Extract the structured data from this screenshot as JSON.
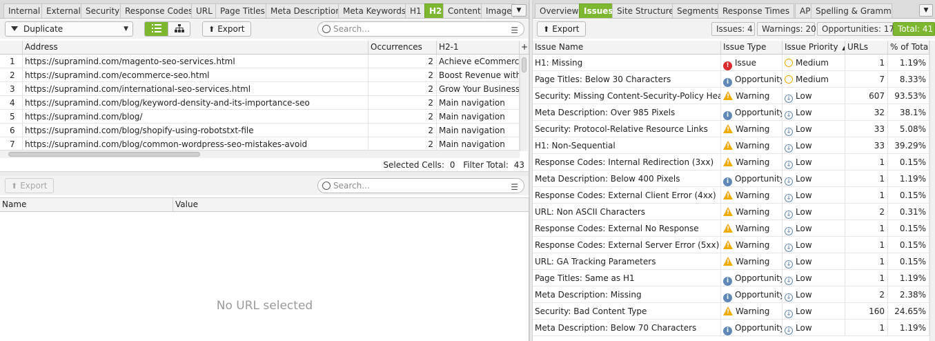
{
  "left": {
    "tabs": [
      "Internal",
      "External",
      "Security",
      "Response Codes",
      "URL",
      "Page Titles",
      "Meta Description",
      "Meta Keywords",
      "H1",
      "H2",
      "Content",
      "Images"
    ],
    "active_tab": "H2",
    "filter_value": "Duplicate",
    "export_label": "Export",
    "search_placeholder": "Search...",
    "columns": [
      "Address",
      "Occurrences",
      "H2-1"
    ],
    "rows": [
      {
        "n": "1",
        "address": "https://supramind.com/magento-seo-services.html",
        "occ": "2",
        "h2": "Achieve eCommerce S"
      },
      {
        "n": "2",
        "address": "https://supramind.com/ecommerce-seo.html",
        "occ": "2",
        "h2": "Boost Revenue with E"
      },
      {
        "n": "3",
        "address": "https://supramind.com/international-seo-services.html",
        "occ": "2",
        "h2": "Grow Your Business W"
      },
      {
        "n": "4",
        "address": "https://supramind.com/blog/keyword-density-and-its-importance-seo",
        "occ": "2",
        "h2": "Main navigation"
      },
      {
        "n": "5",
        "address": "https://supramind.com/blog/",
        "occ": "2",
        "h2": "Main navigation"
      },
      {
        "n": "6",
        "address": "https://supramind.com/blog/shopify-using-robotstxt-file",
        "occ": "2",
        "h2": "Main navigation"
      },
      {
        "n": "7",
        "address": "https://supramind.com/blog/common-wordpress-seo-mistakes-avoid",
        "occ": "2",
        "h2": "Main navigation"
      }
    ],
    "status_selected_label": "Selected Cells:",
    "status_selected_value": "0",
    "status_filter_label": "Filter Total:",
    "status_filter_value": "43",
    "detail": {
      "export_label": "Export",
      "search_placeholder": "Search...",
      "columns": [
        "Name",
        "Value"
      ],
      "empty_text": "No URL selected"
    }
  },
  "right": {
    "tabs": [
      "Overview",
      "Issues",
      "Site Structure",
      "Segments",
      "Response Times",
      "API",
      "Spelling & Grammar"
    ],
    "active_tab": "Issues",
    "export_label": "Export",
    "summary": {
      "issues": "Issues: 4",
      "warnings": "Warnings: 20",
      "opportunities": "Opportunities: 17",
      "total": "Total: 41"
    },
    "columns": [
      "Issue Name",
      "Issue Type",
      "Issue Priority",
      "URLs",
      "% of Total"
    ],
    "rows": [
      {
        "name": "H1: Missing",
        "type": "Issue",
        "type_icon": "error-icon",
        "priority": "Medium",
        "urls": "1",
        "pct": "1.19%"
      },
      {
        "name": "Page Titles: Below 30 Characters",
        "type": "Opportunity",
        "type_icon": "info-icon",
        "priority": "Medium",
        "urls": "7",
        "pct": "8.33%"
      },
      {
        "name": "Security: Missing Content-Security-Policy Header",
        "type": "Warning",
        "type_icon": "warning-icon",
        "priority": "Low",
        "urls": "607",
        "pct": "93.53%"
      },
      {
        "name": "Meta Description: Over 985 Pixels",
        "type": "Opportunity",
        "type_icon": "info-icon",
        "priority": "Low",
        "urls": "32",
        "pct": "38.1%"
      },
      {
        "name": "Security: Protocol-Relative Resource Links",
        "type": "Warning",
        "type_icon": "warning-icon",
        "priority": "Low",
        "urls": "33",
        "pct": "5.08%"
      },
      {
        "name": "H1: Non-Sequential",
        "type": "Warning",
        "type_icon": "warning-icon",
        "priority": "Low",
        "urls": "33",
        "pct": "39.29%"
      },
      {
        "name": "Response Codes: Internal Redirection (3xx)",
        "type": "Warning",
        "type_icon": "warning-icon",
        "priority": "Low",
        "urls": "1",
        "pct": "0.15%"
      },
      {
        "name": "Meta Description: Below 400 Pixels",
        "type": "Opportunity",
        "type_icon": "info-icon",
        "priority": "Low",
        "urls": "1",
        "pct": "1.19%"
      },
      {
        "name": "Response Codes: External Client Error (4xx)",
        "type": "Warning",
        "type_icon": "warning-icon",
        "priority": "Low",
        "urls": "1",
        "pct": "0.15%"
      },
      {
        "name": "URL: Non ASCII Characters",
        "type": "Warning",
        "type_icon": "warning-icon",
        "priority": "Low",
        "urls": "2",
        "pct": "0.31%"
      },
      {
        "name": "Response Codes: External No Response",
        "type": "Warning",
        "type_icon": "warning-icon",
        "priority": "Low",
        "urls": "1",
        "pct": "0.15%"
      },
      {
        "name": "Response Codes: External Server Error (5xx)",
        "type": "Warning",
        "type_icon": "warning-icon",
        "priority": "Low",
        "urls": "1",
        "pct": "0.15%"
      },
      {
        "name": "URL: GA Tracking Parameters",
        "type": "Warning",
        "type_icon": "warning-icon",
        "priority": "Low",
        "urls": "1",
        "pct": "0.15%"
      },
      {
        "name": "Page Titles: Same as H1",
        "type": "Opportunity",
        "type_icon": "info-icon",
        "priority": "Low",
        "urls": "1",
        "pct": "1.19%"
      },
      {
        "name": "Meta Description: Missing",
        "type": "Opportunity",
        "type_icon": "info-icon",
        "priority": "Low",
        "urls": "2",
        "pct": "2.38%"
      },
      {
        "name": "Security: Bad Content Type",
        "type": "Warning",
        "type_icon": "warning-icon",
        "priority": "Low",
        "urls": "160",
        "pct": "24.65%"
      },
      {
        "name": "Meta Description: Below 70 Characters",
        "type": "Opportunity",
        "type_icon": "info-icon",
        "priority": "Low",
        "urls": "1",
        "pct": "1.19%"
      }
    ]
  },
  "colors": {
    "accent_green": "#7cb72f",
    "issue_red": "#d92b2b",
    "warning_amber": "#f2a900",
    "info_blue": "#5f88b8"
  }
}
